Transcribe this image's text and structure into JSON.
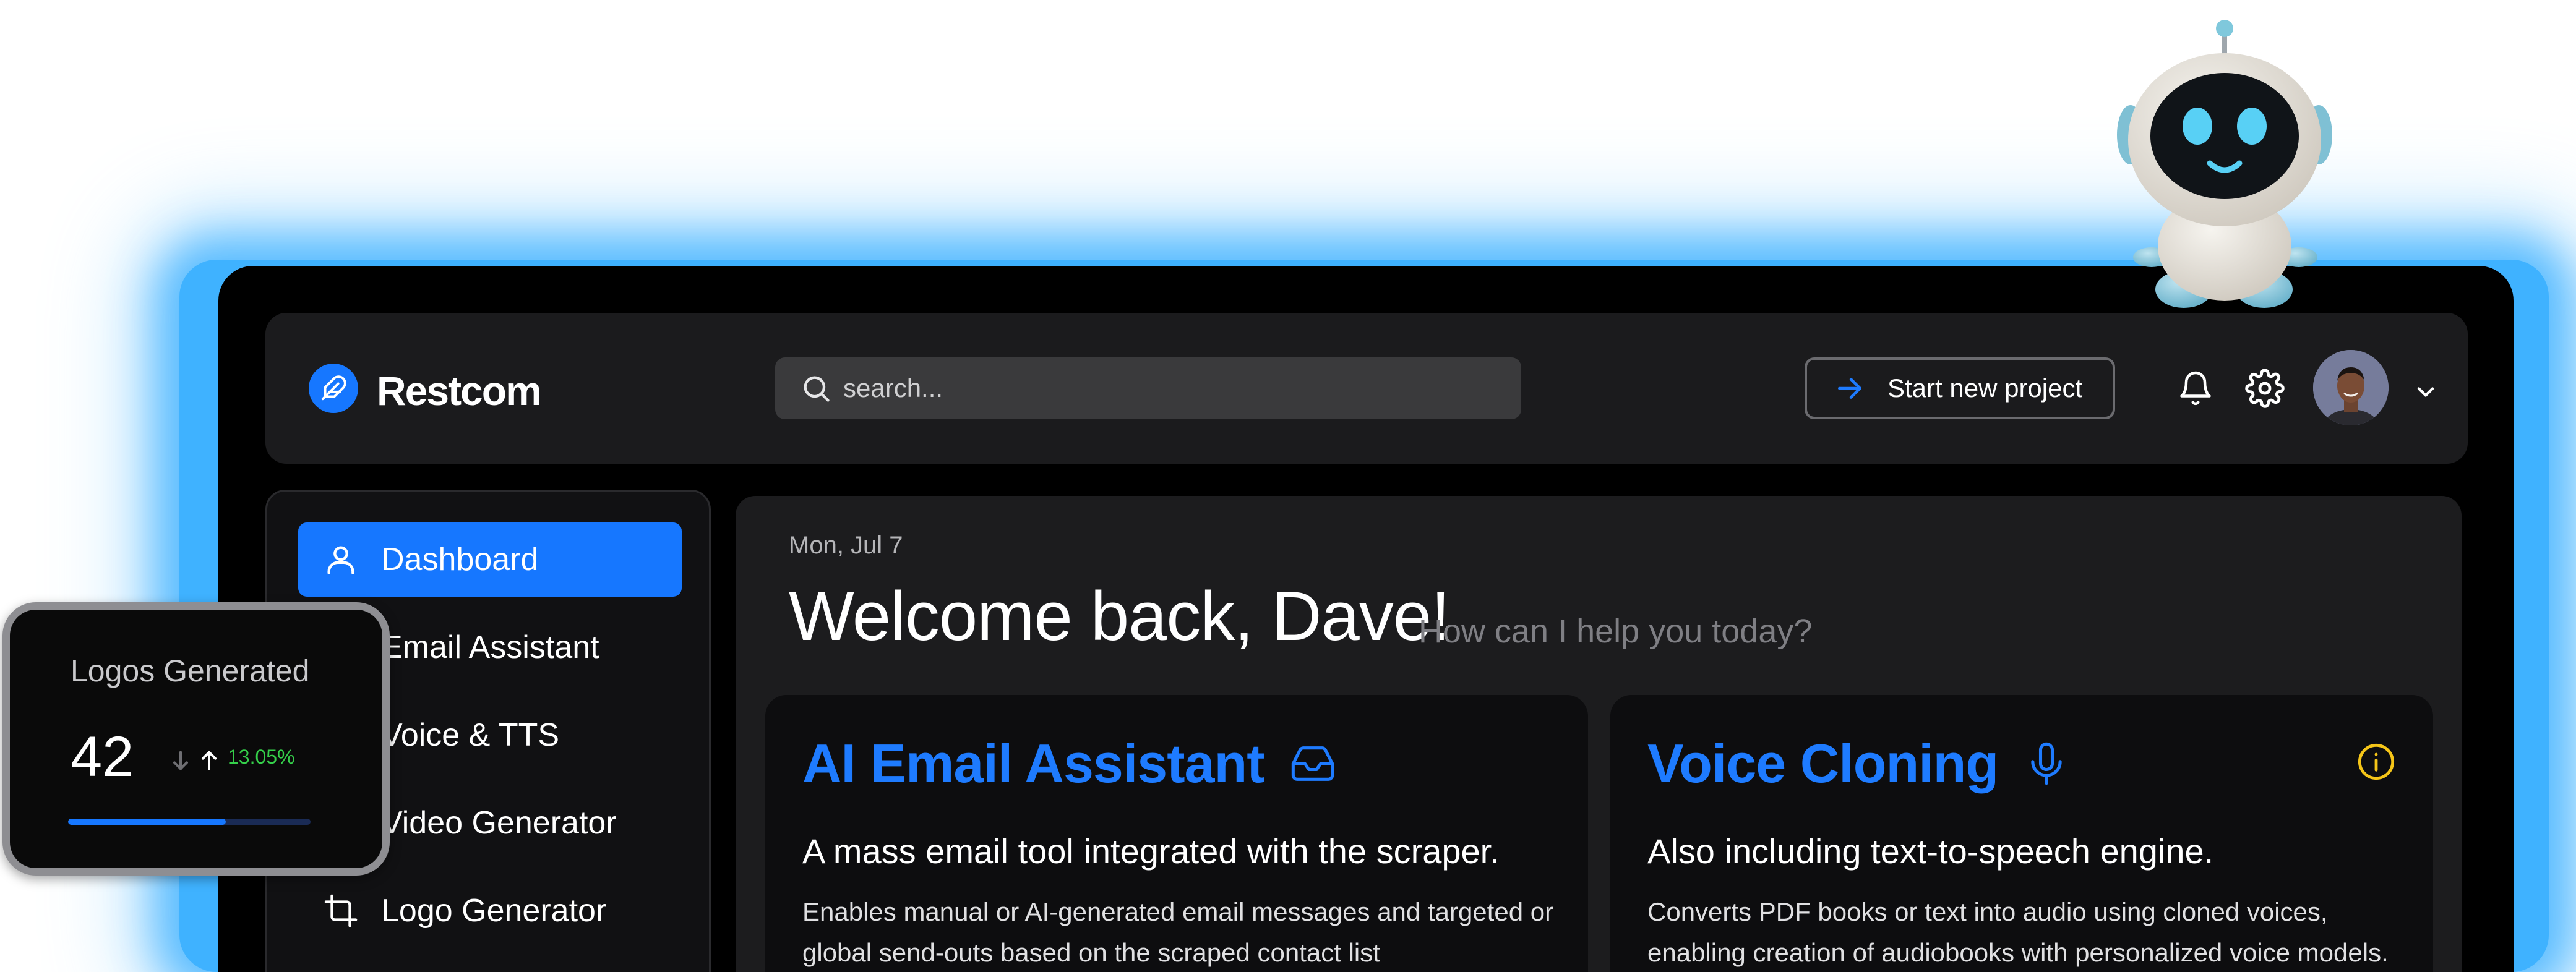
{
  "brand": {
    "name": "Restcom",
    "accent": "#1677ff"
  },
  "header": {
    "search_placeholder": "search...",
    "start_button": "Start new project"
  },
  "sidebar": {
    "items": [
      {
        "label": "Dashboard",
        "icon": "user-icon",
        "active": true
      },
      {
        "label": "Email Assistant",
        "icon": "mail-icon",
        "active": false
      },
      {
        "label": "Voice & TTS",
        "icon": "mic-icon",
        "active": false
      },
      {
        "label": "Video Generator",
        "icon": "video-icon",
        "active": false
      },
      {
        "label": "Logo Generator",
        "icon": "crop-icon",
        "active": false
      }
    ]
  },
  "main": {
    "date": "Mon, Jul 7",
    "welcome": "Welcome back, Dave!",
    "help": "How can I help you today?",
    "cards": [
      {
        "title": "AI Email Assistant",
        "icon": "inbox-icon",
        "subtitle": "A mass email tool integrated with the scraper.",
        "description": "Enables manual or AI-generated email messages and targeted or global send-outs based on the scraped contact list"
      },
      {
        "title": "Voice Cloning",
        "icon": "mic-icon",
        "subtitle": "Also including text-to-speech engine.",
        "description": "Converts PDF books or text into audio using cloned voices, enabling creation of audiobooks with personalized voice models."
      }
    ],
    "info_color": "#f5c518"
  },
  "stat_widget": {
    "label": "Logos Generated",
    "value": "42",
    "change": "13.05%",
    "change_color": "#35d04a",
    "progress": 0.65
  }
}
